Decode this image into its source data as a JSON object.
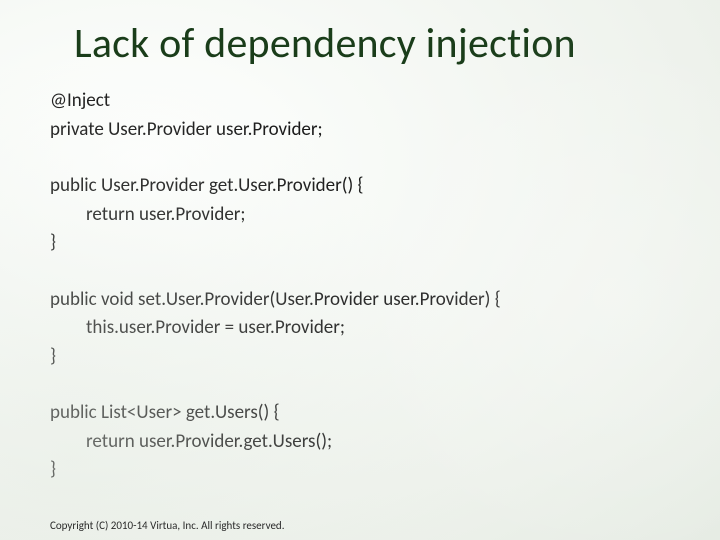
{
  "title": "Lack of dependency injection",
  "code": {
    "l1": "@Inject",
    "l2": "private User.Provider user.Provider;",
    "l3": "public User.Provider get.User.Provider() {",
    "l4": "return user.Provider;",
    "l5": "}",
    "l6": "public void set.User.Provider(User.Provider user.Provider) {",
    "l7": "this.user.Provider = user.Provider;",
    "l8": "}",
    "l9": "public List<User> get.Users() {",
    "l10": "return user.Provider.get.Users();",
    "l11": "}"
  },
  "copyright": "Copyright (C) 2010-14 Virtua, Inc. All rights reserved."
}
